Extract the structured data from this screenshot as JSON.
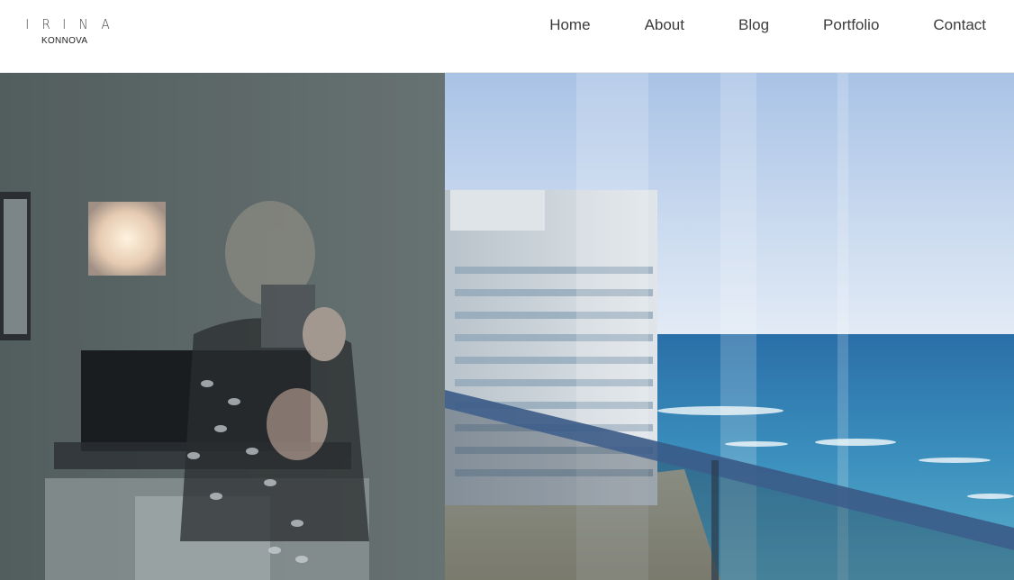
{
  "logo": {
    "mark_letters": [
      "I",
      "R",
      "I",
      "N",
      "A"
    ],
    "subtitle": "KONNOVA"
  },
  "nav": {
    "items": [
      {
        "label": "Home"
      },
      {
        "label": "About"
      },
      {
        "label": "Blog"
      },
      {
        "label": "Portfolio"
      },
      {
        "label": "Contact"
      }
    ]
  },
  "hero": {
    "image_subject": "photo of reflection in balcony glass overlooking ocean and high-rise",
    "colors": {
      "sky_top": "#a9c3e6",
      "sky_bottom": "#dfe9f5",
      "sea": "#2f7fb2",
      "wall": "#5f6a6c",
      "tower": "#cfd6dc"
    }
  }
}
